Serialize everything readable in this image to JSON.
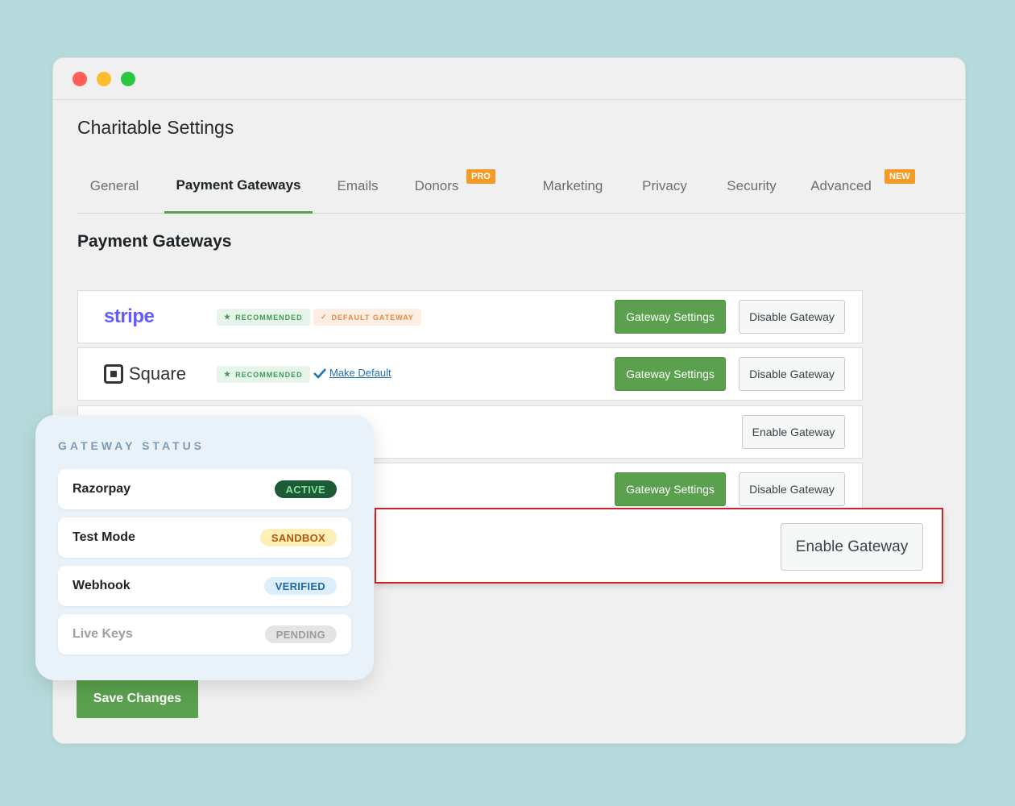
{
  "window": {
    "title": "Charitable Settings"
  },
  "tabs": [
    {
      "label": "General"
    },
    {
      "label": "Payment Gateways",
      "active": true
    },
    {
      "label": "Emails"
    },
    {
      "label": "Donors",
      "badge": "PRO"
    },
    {
      "label": "Marketing"
    },
    {
      "label": "Privacy"
    },
    {
      "label": "Security"
    },
    {
      "label": "Advanced",
      "badge": "NEW"
    }
  ],
  "section_title": "Payment Gateways",
  "gateways": {
    "stripe": {
      "logo_text": "stripe",
      "recommended_pill": "RECOMMENDED",
      "default_pill": "DEFAULT GATEWAY",
      "settings_button": "Gateway Settings",
      "disable_button": "Disable Gateway"
    },
    "square": {
      "logo_text": "Square",
      "recommended_pill": "RECOMMENDED",
      "make_default_link": "Make Default",
      "settings_button": "Gateway Settings",
      "disable_button": "Disable Gateway"
    },
    "row3": {
      "enable_button": "Enable Gateway"
    },
    "row4": {
      "settings_button": "Gateway Settings",
      "disable_button": "Disable Gateway"
    },
    "highlighted": {
      "enable_button": "Enable Gateway"
    }
  },
  "save_button": "Save Changes",
  "status_card": {
    "heading": "GATEWAY STATUS",
    "items": [
      {
        "label": "Razorpay",
        "badge": "ACTIVE",
        "badge_bg": "#1f5a37",
        "badge_color": "#7ee2a0"
      },
      {
        "label": "Test Mode",
        "badge": "SANDBOX",
        "badge_bg": "#fdefb5",
        "badge_color": "#b2560a"
      },
      {
        "label": "Webhook",
        "badge": "VERIFIED",
        "badge_bg": "#dceefb",
        "badge_color": "#1d6aa5"
      },
      {
        "label": "Live Keys",
        "badge": "PENDING",
        "badge_bg": "#e4e4e4",
        "badge_color": "#9b9b9b",
        "muted": true
      }
    ]
  },
  "colors": {
    "accent_green": "#5aa04e",
    "highlight_red": "#d0222c",
    "stripe_purple": "#635bff",
    "badge_orange": "#f49a2a"
  }
}
